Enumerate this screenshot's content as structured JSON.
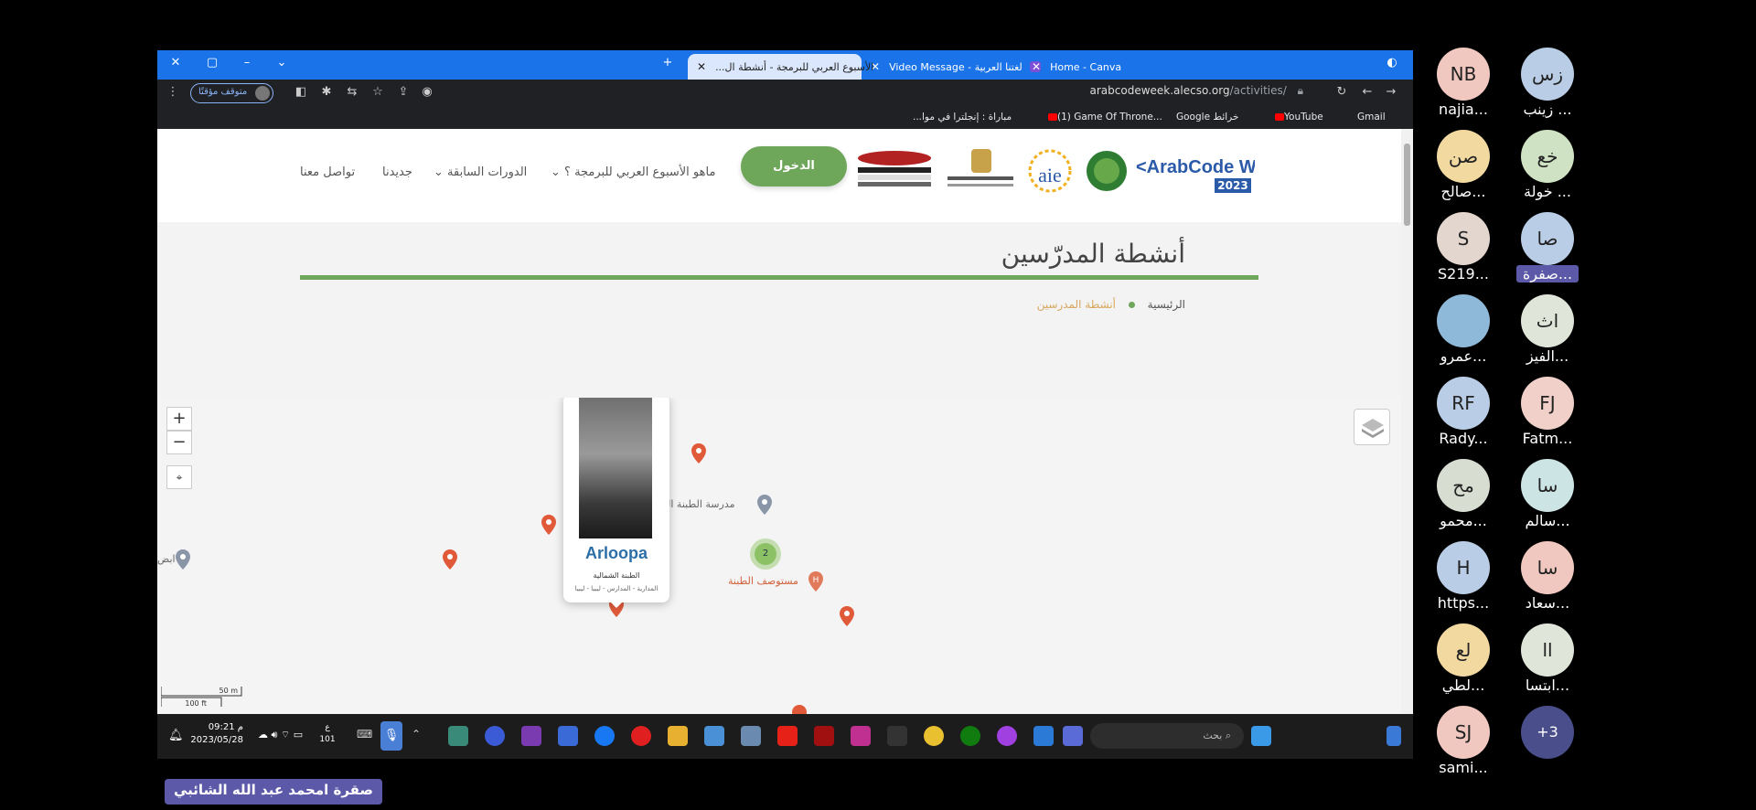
{
  "browser": {
    "tabs": [
      {
        "title": "Home - Canva",
        "active": false
      },
      {
        "title": "Video Message - لغتنا العربية",
        "active": false
      },
      {
        "title": "الأسبوع العربي للبرمجة - أنشطة ال...",
        "active": true
      }
    ],
    "new_tab": "+",
    "url_host": "arabcodeweek.alecso.org",
    "url_path": "/activities/",
    "paused_label": "متوقف مؤقتًا",
    "bookmarks": [
      "Gmail",
      "YouTube",
      "Google خرائط",
      "(1) Game Of Throne...",
      "مباراة : إنجلترا في موا..."
    ]
  },
  "site": {
    "nav": [
      "ماهو الأسبوع العربي للبرمجة ؟",
      "الدورات السابقة",
      "جديدنا",
      "تواصل معنا"
    ],
    "login": "الدخول",
    "logo_text": "<ArabCode Week>",
    "logo_year": "2023",
    "page_title": "أنشطة المدرّسين",
    "breadcrumb_home": "الرئيسية",
    "breadcrumb_current": "أنشطة المدرسين"
  },
  "map": {
    "zoom_in": "+",
    "zoom_out": "−",
    "popup_name": "Arloopa",
    "popup_line1": "الطبنة الشمالية",
    "popup_line2": "المدارية - المدارس - ليبيا - ليبيا",
    "school_label": "مدرسة الطبنة الش",
    "hospital_label": "مستوصف الطبنة",
    "left_label": "ابض",
    "cluster_count": "2",
    "scale_m": "50 m",
    "scale_ft": "100 ft"
  },
  "taskbar": {
    "time": "09:21 م",
    "date": "2023/05/28",
    "temp_unit": "ع",
    "temp": "101",
    "search_placeholder": "بحث"
  },
  "participants": [
    {
      "initials": "زس",
      "name": "زينب ...",
      "color": "#b9cde6"
    },
    {
      "initials": "NB",
      "name": "najia...",
      "color": "#f0c8c0"
    },
    {
      "initials": "خع",
      "name": "خولة ...",
      "color": "#cfe3c4"
    },
    {
      "initials": "صن",
      "name": "صالح...",
      "color": "#f2d9a0"
    },
    {
      "initials": "صا",
      "name": "صفرة...",
      "color": "#b9cde6"
    },
    {
      "initials": "S",
      "name": "S219...",
      "color": "#e3d6ce"
    },
    {
      "initials": "اث",
      "name": "الفيز...",
      "color": "#dfe5d8"
    },
    {
      "initials": "",
      "name": "عمرو...",
      "color": "#8fb9d9"
    },
    {
      "initials": "FJ",
      "name": "Fatm...",
      "color": "#f0d0c8"
    },
    {
      "initials": "RF",
      "name": "Rady...",
      "color": "#b9cde6"
    },
    {
      "initials": "سا",
      "name": "سالم...",
      "color": "#cde4e4"
    },
    {
      "initials": "مح",
      "name": "محمو...",
      "color": "#d7ddd0"
    },
    {
      "initials": "سا",
      "name": "سعاد...",
      "color": "#f0c8c0"
    },
    {
      "initials": "H",
      "name": "https...",
      "color": "#b9cde6"
    },
    {
      "initials": "اا",
      "name": "ابتسا...",
      "color": "#dfe5d8"
    },
    {
      "initials": "لع",
      "name": "لطي...",
      "color": "#f2d9a0"
    },
    {
      "initials": "+3",
      "name": "",
      "color": "#4a4e8a"
    },
    {
      "initials": "SJ",
      "name": "sami...",
      "color": "#f0c8c0"
    }
  ],
  "presenter_name": "صقرة امحمد عبد الله الشائبي"
}
